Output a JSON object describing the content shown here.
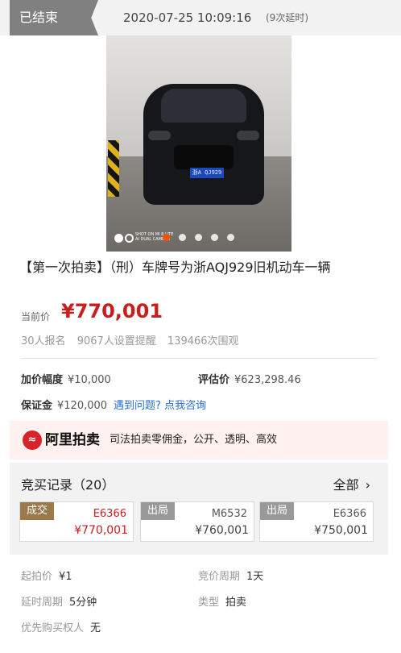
{
  "header": {
    "status": "已结束",
    "end_time": "2020-07-25 10:09:16",
    "delay_note": "(9次延时)"
  },
  "gallery": {
    "plate_text": "浙A QJ929",
    "watermark_line1": "SHOT ON MI 8 LITE",
    "watermark_line2": "AI DUAL CAMERA",
    "active_index": 1,
    "total": 5
  },
  "item": {
    "title": "【第一次拍卖】（刑）车牌号为浙AQJ929旧机动车一辆",
    "price_label": "当前价",
    "price_value": "¥770,001",
    "stat_signups": "30人报名",
    "stat_reminders": "9067人设置提醒",
    "stat_views": "139466次围观"
  },
  "terms": {
    "increment_label": "加价幅度",
    "increment_value": "¥10,000",
    "appraisal_label": "评估价",
    "appraisal_value": "¥623,298.46",
    "deposit_label": "保证金",
    "deposit_value": "¥120,000",
    "help_link": "遇到问题? 点我咨询"
  },
  "banner": {
    "logo_glyph": "≈",
    "brand": "阿里拍卖",
    "slogan": "司法拍卖零佣金，公开、透明、高效"
  },
  "bids": {
    "title": "竞买记录（20）",
    "all_label": "全部",
    "chevron": "›",
    "records": [
      {
        "tag": "成交",
        "user": "E6366",
        "price": "¥770,001"
      },
      {
        "tag": "出局",
        "user": "M6532",
        "price": "¥760,001"
      },
      {
        "tag": "出局",
        "user": "E6366",
        "price": "¥750,001"
      }
    ]
  },
  "details": {
    "start_price_label": "起拍价",
    "start_price_value": "¥1",
    "bid_period_label": "竞价周期",
    "bid_period_value": "1天",
    "delay_period_label": "延时周期",
    "delay_period_value": "5分钟",
    "type_label": "类型",
    "type_value": "拍卖",
    "priority_label": "优先购买权人",
    "priority_value": "无"
  },
  "colors": {
    "price_red": "#c81e1e",
    "link_blue": "#2a6fd6",
    "win_tag": "#9a7a4b",
    "out_tag": "#999999",
    "status_grey": "#808080"
  }
}
